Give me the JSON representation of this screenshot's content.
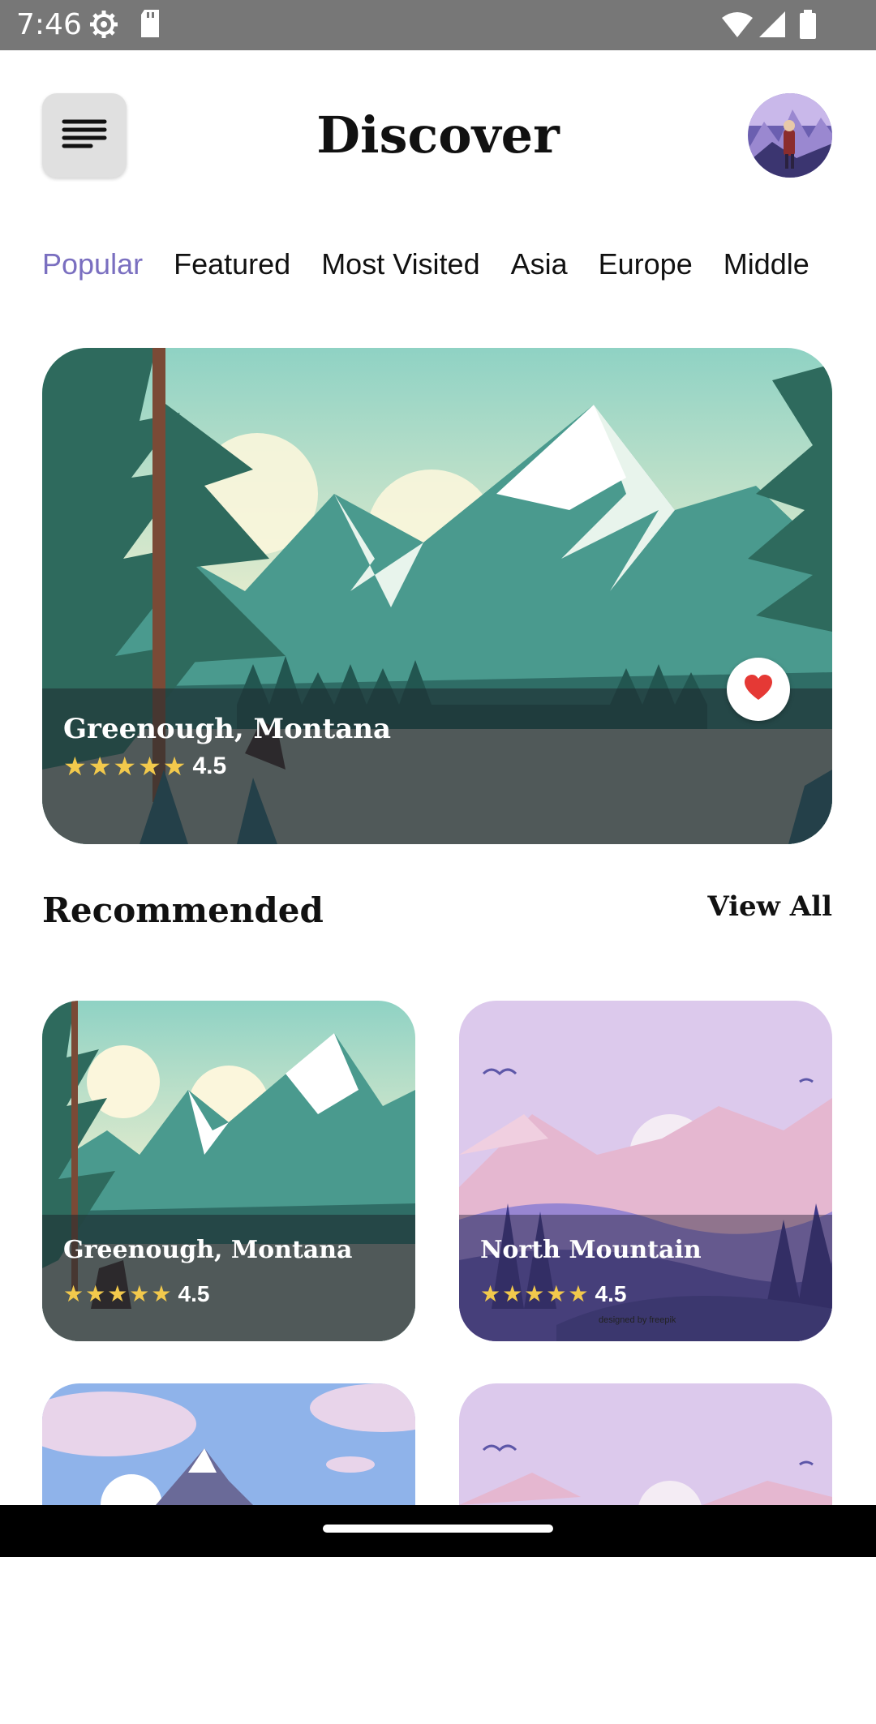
{
  "status_bar": {
    "time": "7:46"
  },
  "header": {
    "title": "Discover"
  },
  "tabs": [
    {
      "label": "Popular",
      "active": true
    },
    {
      "label": "Featured",
      "active": false
    },
    {
      "label": "Most Visited",
      "active": false
    },
    {
      "label": "Asia",
      "active": false
    },
    {
      "label": "Europe",
      "active": false
    },
    {
      "label": "Middle",
      "active": false
    }
  ],
  "featured": {
    "title": "Greenough, Montana",
    "stars": "★★★★★",
    "rating": "4.5",
    "favorited": true
  },
  "recommended": {
    "title": "Recommended",
    "view_all": "View All",
    "cards": [
      {
        "title": "Greenough, Montana",
        "stars": "★★★★★",
        "rating": "4.5"
      },
      {
        "title": "North Mountain",
        "stars": "★★★★★",
        "rating": "4.5",
        "credit": "designed by freepik"
      }
    ]
  },
  "colors": {
    "accent": "#7a6fc0",
    "star": "#f2c94c",
    "heart": "#e53935"
  },
  "icons": {
    "menu": "menu-icon",
    "settings": "settings-icon",
    "sd": "sd-card-icon",
    "wifi": "wifi-icon",
    "signal": "signal-icon",
    "battery": "battery-icon",
    "heart": "heart-icon"
  }
}
